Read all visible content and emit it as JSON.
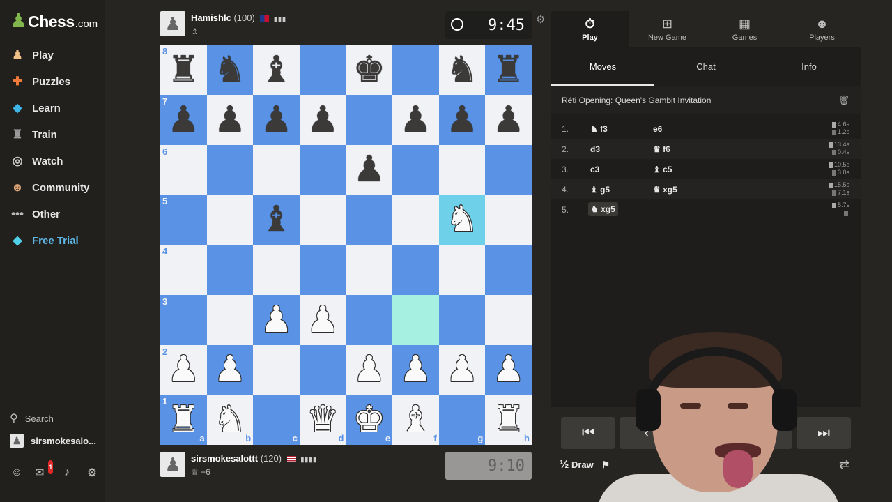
{
  "brand": {
    "name": "Chess",
    "suffix": ".com"
  },
  "sidebar": {
    "items": [
      {
        "label": "Play",
        "icon": "play-pawn-icon"
      },
      {
        "label": "Puzzles",
        "icon": "puzzle-icon"
      },
      {
        "label": "Learn",
        "icon": "learn-cap-icon"
      },
      {
        "label": "Train",
        "icon": "train-icon"
      },
      {
        "label": "Watch",
        "icon": "binoculars-icon"
      },
      {
        "label": "Community",
        "icon": "community-icon"
      },
      {
        "label": "Other",
        "icon": "more-dots-icon"
      },
      {
        "label": "Free Trial",
        "icon": "diamond-icon"
      }
    ],
    "search_label": "Search",
    "username": "sirsmokesalo...",
    "notification_count": "1"
  },
  "top_player": {
    "name": "Hamishlc",
    "rating": "(100)",
    "clock": "9:45"
  },
  "bottom_player": {
    "name": "sirsmokesalottt",
    "rating": "(120)",
    "material": "+6",
    "clock": "9:10"
  },
  "board": {
    "rank_labels": [
      "8",
      "7",
      "6",
      "5",
      "4",
      "3",
      "2",
      "1"
    ],
    "file_labels": [
      "a",
      "b",
      "c",
      "d",
      "e",
      "f",
      "g",
      "h"
    ],
    "rows": [
      [
        "br",
        "bn",
        "bb",
        "",
        "bk",
        "",
        "bn",
        "br"
      ],
      [
        "bp",
        "bp",
        "bp",
        "bp",
        "",
        "bp",
        "bp",
        "bp"
      ],
      [
        "",
        "",
        "",
        "",
        "bp",
        "",
        "",
        ""
      ],
      [
        "",
        "",
        "bb",
        "",
        "",
        "",
        "wn",
        ""
      ],
      [
        "",
        "",
        "",
        "",
        "",
        "",
        "",
        ""
      ],
      [
        "",
        "",
        "wp",
        "wp",
        "",
        "",
        "",
        ""
      ],
      [
        "wp",
        "wp",
        "",
        "",
        "wp",
        "wp",
        "wp",
        "wp"
      ],
      [
        "wr",
        "wn",
        "",
        "wq",
        "wk",
        "wb",
        "",
        "wr"
      ]
    ]
  },
  "panel": {
    "nav": [
      {
        "label": "Play",
        "icon": "stopwatch-icon"
      },
      {
        "label": "New Game",
        "icon": "plus-icon"
      },
      {
        "label": "Games",
        "icon": "board-icon"
      },
      {
        "label": "Players",
        "icon": "players-icon"
      }
    ],
    "tabs": [
      "Moves",
      "Chat",
      "Info"
    ],
    "opening": "Réti Opening: Queen's Gambit Invitation",
    "moves": [
      {
        "num": "1.",
        "white": "♞ f3",
        "black": "e6",
        "tw": "4.6s",
        "tb": "1.2s"
      },
      {
        "num": "2.",
        "white": "d3",
        "black": "♛ f6",
        "tw": "13.4s",
        "tb": "0.4s"
      },
      {
        "num": "3.",
        "white": "c3",
        "black": "♝ c5",
        "tw": "10.5s",
        "tb": "3.0s"
      },
      {
        "num": "4.",
        "white": "♝ g5",
        "black": "♛ xg5",
        "tw": "15.5s",
        "tb": "7.1s"
      },
      {
        "num": "5.",
        "white": "♞ xg5",
        "black": "",
        "tw": "5.7s",
        "tb": ""
      }
    ],
    "draw_label": "Draw",
    "draw_prefix": "½"
  }
}
